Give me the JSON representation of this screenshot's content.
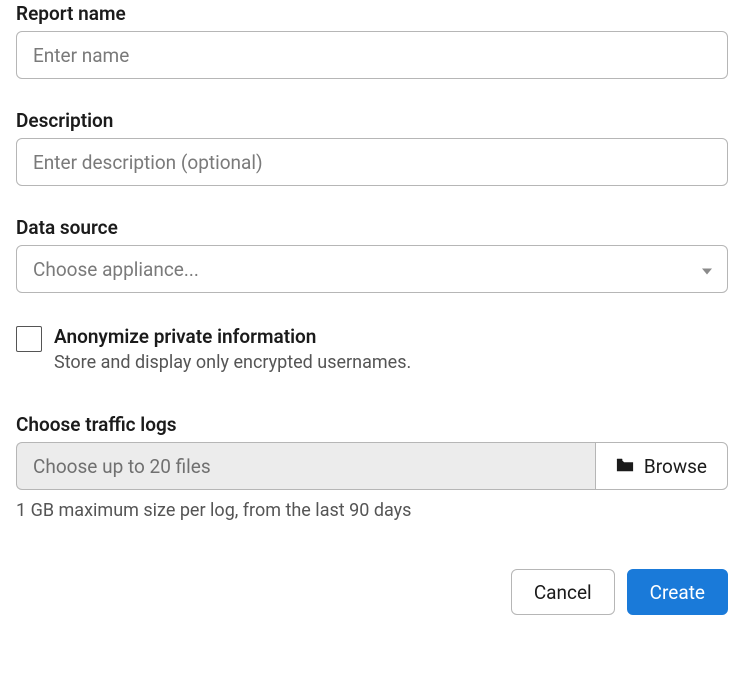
{
  "reportName": {
    "label": "Report name",
    "placeholder": "Enter name",
    "value": ""
  },
  "description": {
    "label": "Description",
    "placeholder": "Enter description (optional)",
    "value": ""
  },
  "dataSource": {
    "label": "Data source",
    "placeholder": "Choose appliance..."
  },
  "anonymize": {
    "label": "Anonymize private information",
    "help": "Store and display only encrypted usernames.",
    "checked": false
  },
  "trafficLogs": {
    "label": "Choose traffic logs",
    "placeholder": "Choose up to 20 files",
    "browseLabel": "Browse",
    "hint": "1 GB maximum size per log, from the last 90 days"
  },
  "footer": {
    "cancel": "Cancel",
    "create": "Create"
  }
}
